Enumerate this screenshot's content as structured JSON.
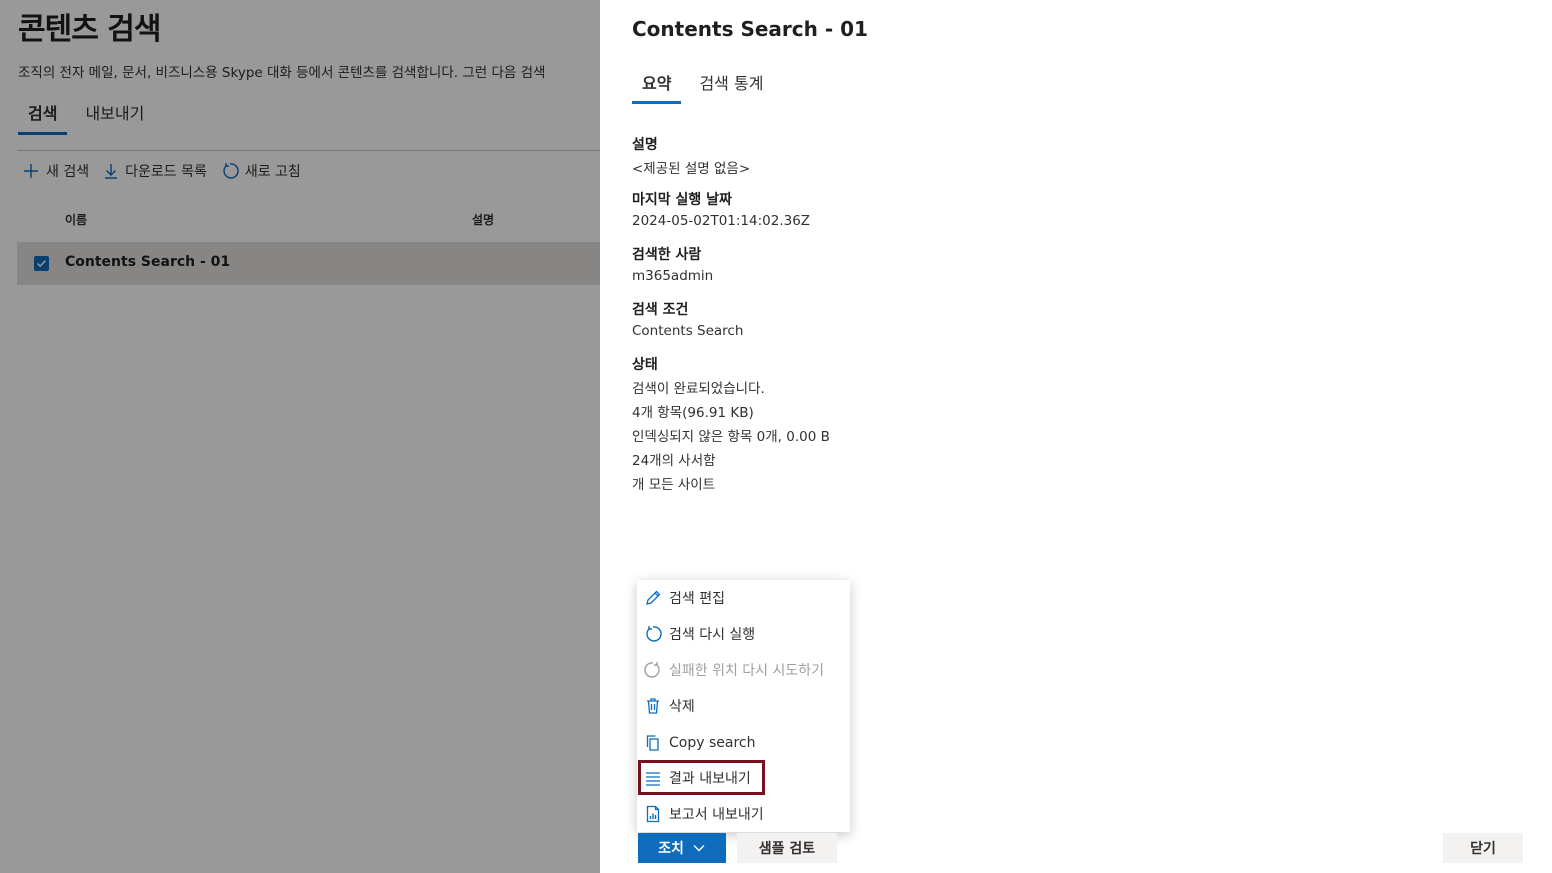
{
  "page": {
    "title": "콘텐츠 검색",
    "description": "조직의 전자 메일, 문서, 비즈니스용 Skype 대화 등에서 콘텐츠를 검색합니다. 그런 다음 검색",
    "tabs": [
      {
        "label": "검색",
        "active": true
      },
      {
        "label": "내보내기",
        "active": false
      }
    ],
    "toolbar": {
      "new_search": "새 검색",
      "download_list": "다운로드 목록",
      "refresh": "새로 고침"
    },
    "list": {
      "columns": {
        "name": "이름",
        "description": "설명"
      },
      "rows": [
        {
          "name": "Contents Search - 01",
          "checked": true
        }
      ]
    }
  },
  "panel": {
    "title": "Contents Search - 01",
    "tabs": [
      {
        "label": "요약",
        "active": true
      },
      {
        "label": "검색 통계",
        "active": false
      }
    ],
    "fields": {
      "description": {
        "label": "설명",
        "value": "<제공된 설명 없음>"
      },
      "last_run": {
        "label": "마지막 실행 날짜",
        "value": "2024-05-02T01:14:02.36Z"
      },
      "searched_by": {
        "label": "검색한 사람",
        "value": "m365admin"
      },
      "query": {
        "label": "검색 조건",
        "value": "Contents Search"
      },
      "status": {
        "label": "상태",
        "lines": [
          "검색이 완료되었습니다.",
          "4개 항목(96.91 KB)",
          "인덱싱되지 않은 항목 0개, 0.00 B",
          "24개의 사서함",
          "개 모든 사이트"
        ]
      }
    }
  },
  "menu": {
    "items": [
      {
        "label": "검색 편집",
        "icon": "pencil-icon",
        "disabled": false
      },
      {
        "label": "검색 다시 실행",
        "icon": "refresh-icon",
        "disabled": false
      },
      {
        "label": "실패한 위치 다시 시도하기",
        "icon": "retry-icon",
        "disabled": true
      },
      {
        "label": "삭제",
        "icon": "trash-icon",
        "disabled": false
      },
      {
        "label": "Copy search",
        "icon": "copy-icon",
        "disabled": false
      },
      {
        "label": "결과 내보내기",
        "icon": "list-icon",
        "disabled": false,
        "highlighted": true
      },
      {
        "label": "보고서 내보내기",
        "icon": "report-icon",
        "disabled": false
      }
    ]
  },
  "footer": {
    "actions_label": "조치",
    "sample_review_label": "샘플 검토",
    "close_label": "닫기"
  },
  "colors": {
    "accent": "#0f6cbd",
    "highlight_border": "#7a0f22",
    "overlay": "rgba(0,0,0,0.4)"
  }
}
